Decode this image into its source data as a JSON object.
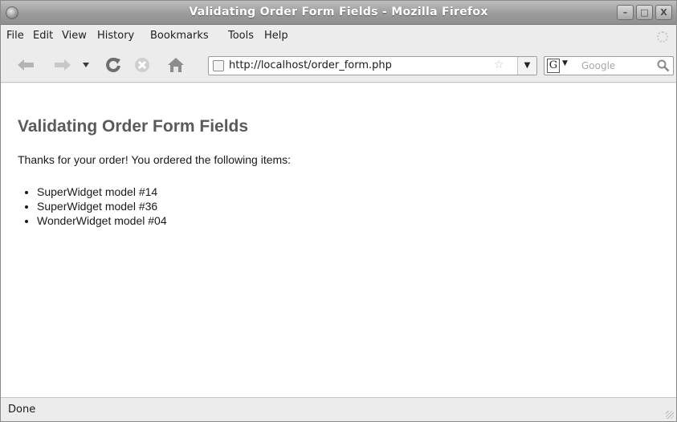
{
  "window": {
    "title": "Validating Order Form Fields - Mozilla Firefox",
    "controls": {
      "minimize": "–",
      "maximize": "□",
      "close": "X"
    }
  },
  "menu": {
    "items": [
      "File",
      "Edit",
      "View",
      "History",
      "Bookmarks",
      "Tools",
      "Help"
    ]
  },
  "toolbar": {
    "url": "http://localhost/order_form.php",
    "search_engine": "G",
    "search_placeholder": "Google",
    "icons": [
      "back-arrow-icon",
      "forward-arrow-icon",
      "history-dropdown-icon",
      "reload-icon",
      "stop-icon",
      "home-icon",
      "bookmark-star-icon",
      "search-icon"
    ]
  },
  "page": {
    "heading": "Validating Order Form Fields",
    "message": "Thanks for your order! You ordered the following items:",
    "items": [
      "SuperWidget model #14",
      "SuperWidget model #36",
      "WonderWidget model #04"
    ]
  },
  "status": {
    "text": "Done"
  },
  "colors": {
    "heading": "#5a5a5a",
    "chrome": "#ececec",
    "titlebar": "#9c9c9c"
  }
}
